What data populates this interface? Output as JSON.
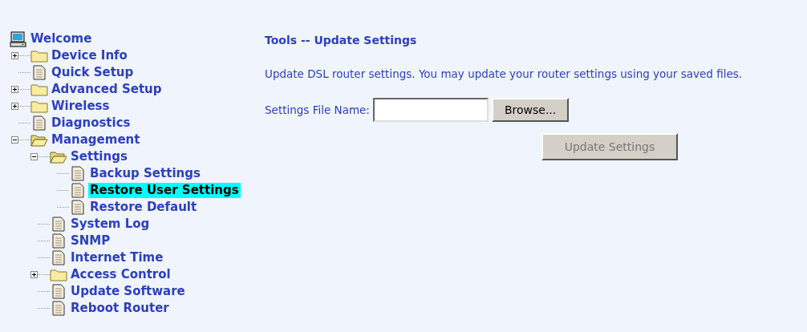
{
  "tree": {
    "label": "Welcome",
    "kind": "computer",
    "selected": false,
    "children": [
      {
        "label": "Device Info",
        "kind": "folder",
        "expanded": false,
        "selected": false
      },
      {
        "label": "Quick Setup",
        "kind": "page",
        "selected": false
      },
      {
        "label": "Advanced Setup",
        "kind": "folder",
        "expanded": false,
        "selected": false
      },
      {
        "label": "Wireless",
        "kind": "folder",
        "expanded": false,
        "selected": false
      },
      {
        "label": "Diagnostics",
        "kind": "page",
        "selected": false
      },
      {
        "label": "Management",
        "kind": "folder",
        "expanded": true,
        "selected": false,
        "children": [
          {
            "label": "Settings",
            "kind": "folder",
            "expanded": true,
            "selected": false,
            "children": [
              {
                "label": "Backup Settings",
                "kind": "page",
                "selected": false
              },
              {
                "label": "Restore User Settings",
                "kind": "page",
                "selected": true
              },
              {
                "label": "Restore Default",
                "kind": "page",
                "selected": false
              }
            ]
          },
          {
            "label": "System Log",
            "kind": "page",
            "selected": false
          },
          {
            "label": "SNMP",
            "kind": "page",
            "selected": false
          },
          {
            "label": "Internet Time",
            "kind": "page",
            "selected": false
          },
          {
            "label": "Access Control",
            "kind": "folder",
            "expanded": false,
            "selected": false
          },
          {
            "label": "Update Software",
            "kind": "page",
            "selected": false
          },
          {
            "label": "Reboot Router",
            "kind": "page",
            "selected": false
          }
        ]
      }
    ]
  },
  "content": {
    "title": "Tools -- Update Settings",
    "description": "Update DSL router settings. You may update your router settings using your saved files.",
    "file_field": {
      "label": "Settings File Name:",
      "browse_button": "Browse..."
    },
    "update_button": {
      "label": "Update Settings",
      "disabled": true
    }
  }
}
